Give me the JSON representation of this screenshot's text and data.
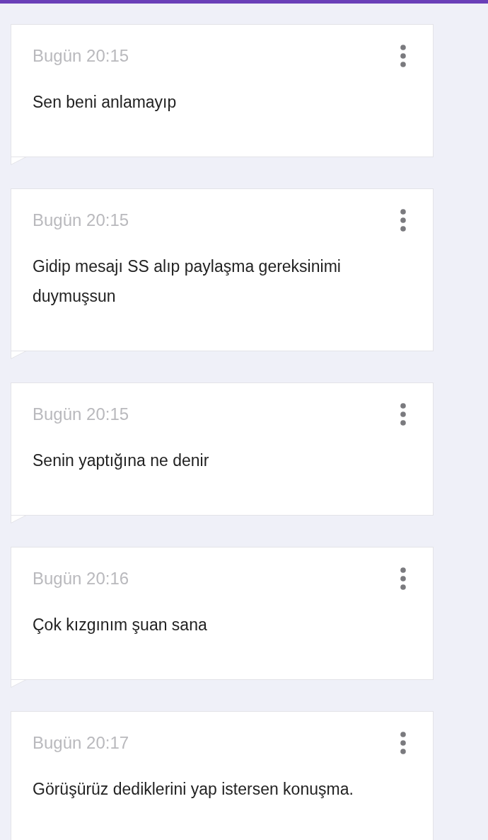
{
  "messages": [
    {
      "time": "Bugün 20:15",
      "text": "Sen beni anlamayıp"
    },
    {
      "time": "Bugün 20:15",
      "text": "Gidip mesajı SS alıp paylaşma gereksinimi duymuşsun"
    },
    {
      "time": "Bugün 20:15",
      "text": "Senin yaptığına ne denir"
    },
    {
      "time": "Bugün 20:16",
      "text": "Çok kızgınım şuan sana"
    },
    {
      "time": "Bugün 20:17",
      "text": "Görüşürüz dediklerini yap istersen konuşma."
    }
  ]
}
